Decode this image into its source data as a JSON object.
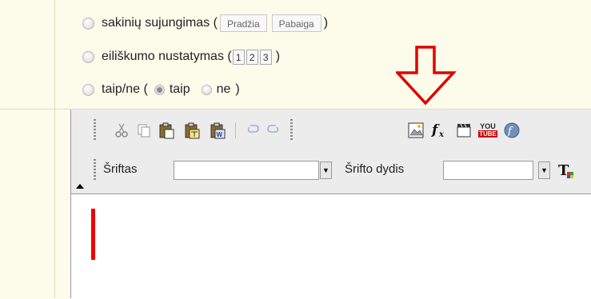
{
  "options": [
    {
      "label": "sakinių sujungimas (",
      "fields": [
        "Pradžia",
        "Pabaiga"
      ],
      "close": ")"
    },
    {
      "label": "eiliškumo nustatymas (",
      "numbers": [
        "1",
        "2",
        "3"
      ],
      "close": ")"
    },
    {
      "label": "taip/ne (",
      "choices": [
        {
          "label": "taip",
          "checked": true
        },
        {
          "label": "ne",
          "checked": false
        }
      ],
      "close": ")"
    }
  ],
  "toolbar": {
    "icons": [
      "cut-icon",
      "copy-icon",
      "paste-icon",
      "paste-text-icon",
      "paste-word-icon",
      "undo-icon",
      "redo-icon",
      "image-icon",
      "formula-icon",
      "video-icon",
      "youtube-icon",
      "flash-icon"
    ],
    "font_label": "Šriftas",
    "font_value": "",
    "size_label": "Šrifto dydis",
    "size_value": "",
    "youtube_top": "YOU",
    "youtube_bottom": "TUBE"
  },
  "colors": {
    "background": "#fdfbea",
    "arrow": "#e00000",
    "caret": "#e00000"
  }
}
